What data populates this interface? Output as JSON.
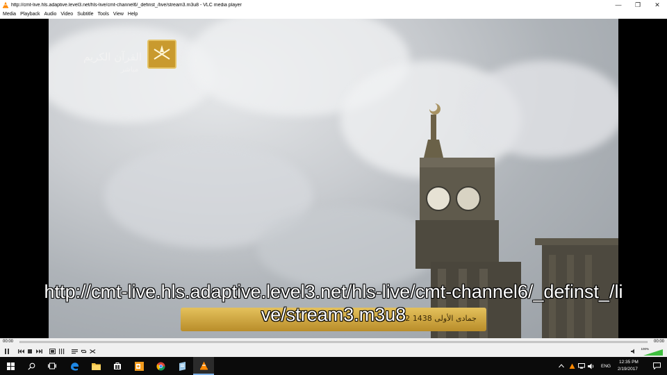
{
  "window": {
    "title": "http://cmt-live.hls.adaptive.level3.net/hls-live/cmt-channel6/_definst_/live/stream3.m3u8 - VLC media player",
    "minimize_glyph": "—",
    "maximize_glyph": "❐",
    "close_glyph": "✕"
  },
  "menu": [
    "Media",
    "Playback",
    "Audio",
    "Video",
    "Subtitle",
    "Tools",
    "View",
    "Help"
  ],
  "video": {
    "url_overlay": "http://cmt-live.hls.adaptive.level3.net/hls-live/cmt-channel6/_definst_/live/stream3.m3u8",
    "channel_logo_text": "القرآن الكريم",
    "channel_logo_sub": "مباشر",
    "ticker_text": "22 جمادى الأولى 1438"
  },
  "playback": {
    "elapsed": "00:00",
    "remaining": "00:00",
    "progress": 0
  },
  "volume": {
    "label": "100%",
    "level": 1.0
  },
  "taskbar": {
    "language": "ENG",
    "time": "12:35 PM",
    "date": "2/19/2017"
  },
  "colors": {
    "vlc_orange": "#ff8800",
    "taskbar_bg": "#0b0b0b",
    "volume_green": "#3fbf3f"
  }
}
